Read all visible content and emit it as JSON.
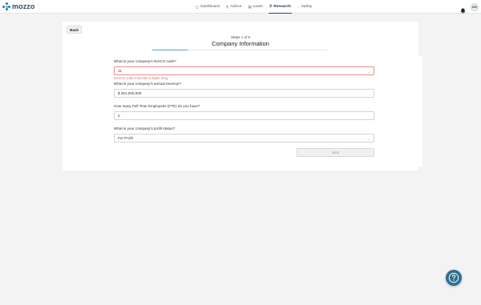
{
  "brand": {
    "name": "mozzo",
    "color": "#2b79b5"
  },
  "nav": [
    {
      "label": "Dashboard",
      "icon": "dashboard-icon",
      "active": false
    },
    {
      "label": "Advice",
      "icon": "advice-icon",
      "active": false
    },
    {
      "label": "Learn",
      "icon": "learn-icon",
      "active": false
    },
    {
      "label": "Research",
      "icon": "research-icon",
      "active": true
    },
    {
      "label": "Safety",
      "icon": "safety-icon",
      "active": false
    }
  ],
  "user": {
    "initials": "DG"
  },
  "form": {
    "back_label": "Back",
    "steps_text": "Steps 1 of 5",
    "title": "Company Information",
    "progress": 0.2,
    "naics": {
      "label": "What is your company's NAICS code?",
      "value": "11",
      "error": "NAICS code must be 6 digits long"
    },
    "revenue": {
      "label": "What is your company's annual revenue?",
      "value": "$ 251,000,000"
    },
    "fte": {
      "label": "How many Full Time Employees (FTE) do you have?",
      "value": "2"
    },
    "profit": {
      "label": "What is your company's profit status?",
      "value": "For Profit"
    },
    "next_label": "Next"
  },
  "colors": {
    "accent": "#5a9ec9",
    "error": "#e07070",
    "help": "#2e6f8e"
  }
}
